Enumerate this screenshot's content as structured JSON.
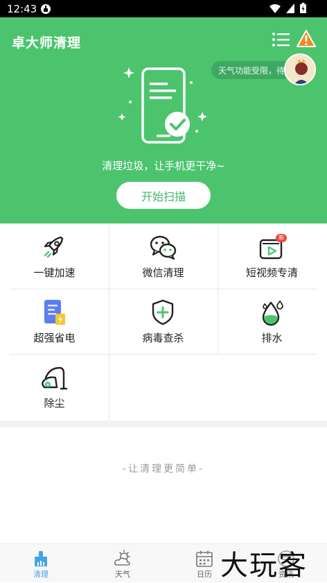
{
  "status_bar": {
    "time": "12:43"
  },
  "header": {
    "title": "卓大师清理",
    "toast": "天气功能受限，待修复"
  },
  "hero": {
    "slogan": "清理垃圾，让手机更干净~",
    "scan_button": "开始扫描"
  },
  "features": [
    {
      "label": "一键加速",
      "icon": "rocket-icon"
    },
    {
      "label": "微信清理",
      "icon": "wechat-icon"
    },
    {
      "label": "短视频专清",
      "icon": "video-icon",
      "badge": "新"
    },
    {
      "label": "超强省电",
      "icon": "battery-icon"
    },
    {
      "label": "病毒查杀",
      "icon": "shield-icon"
    },
    {
      "label": "排水",
      "icon": "water-icon"
    },
    {
      "label": "除尘",
      "icon": "vacuum-icon"
    }
  ],
  "footer": {
    "text": "-让清理更简单-"
  },
  "tabs": [
    {
      "label": "清理",
      "icon": "broom-icon",
      "active": true
    },
    {
      "label": "天气",
      "icon": "weather-icon"
    },
    {
      "label": "日历",
      "icon": "calendar-icon"
    },
    {
      "label": "资讯",
      "icon": "news-icon"
    }
  ],
  "watermark": "大玩客",
  "colors": {
    "brand_green": "#4cc46e",
    "accent_blue": "#43a4e8",
    "warning": "#f08a24"
  }
}
